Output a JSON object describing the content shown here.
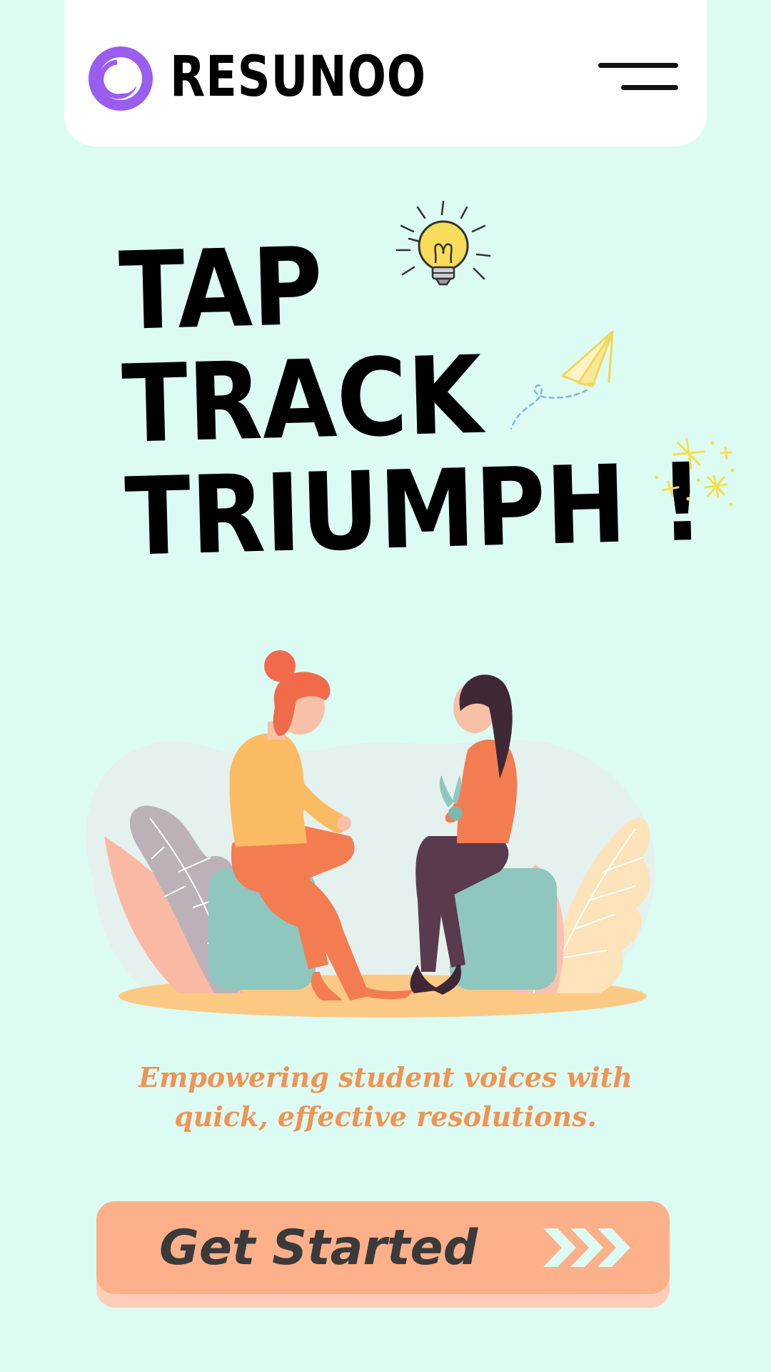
{
  "app": {
    "brand": "RESUNOO"
  },
  "hero": {
    "lines": [
      "TAP",
      "TRACK",
      "TRIUMPH !"
    ]
  },
  "tagline": {
    "line1": "Empowering student voices with",
    "line2": "quick, effective resolutions."
  },
  "cta": {
    "label": "Get Started"
  },
  "icons": {
    "logo": "ring-logo-icon",
    "menu": "hamburger-menu-icon",
    "lightbulb": "lightbulb-icon",
    "paper_plane": "paper-plane-icon",
    "sparkles": "sparkle-icon",
    "arrows": "triple-chevron-right-icon"
  },
  "colors": {
    "background": "#dcfbf3",
    "header": "#ffffff",
    "logo": "#9b5cf0",
    "tagline": "#ef9454",
    "cta": "#fdb08a",
    "cta_shadow": "#ffcdb9",
    "cta_text": "#3a3a3a",
    "cta_arrows": "#dcfbf3"
  }
}
